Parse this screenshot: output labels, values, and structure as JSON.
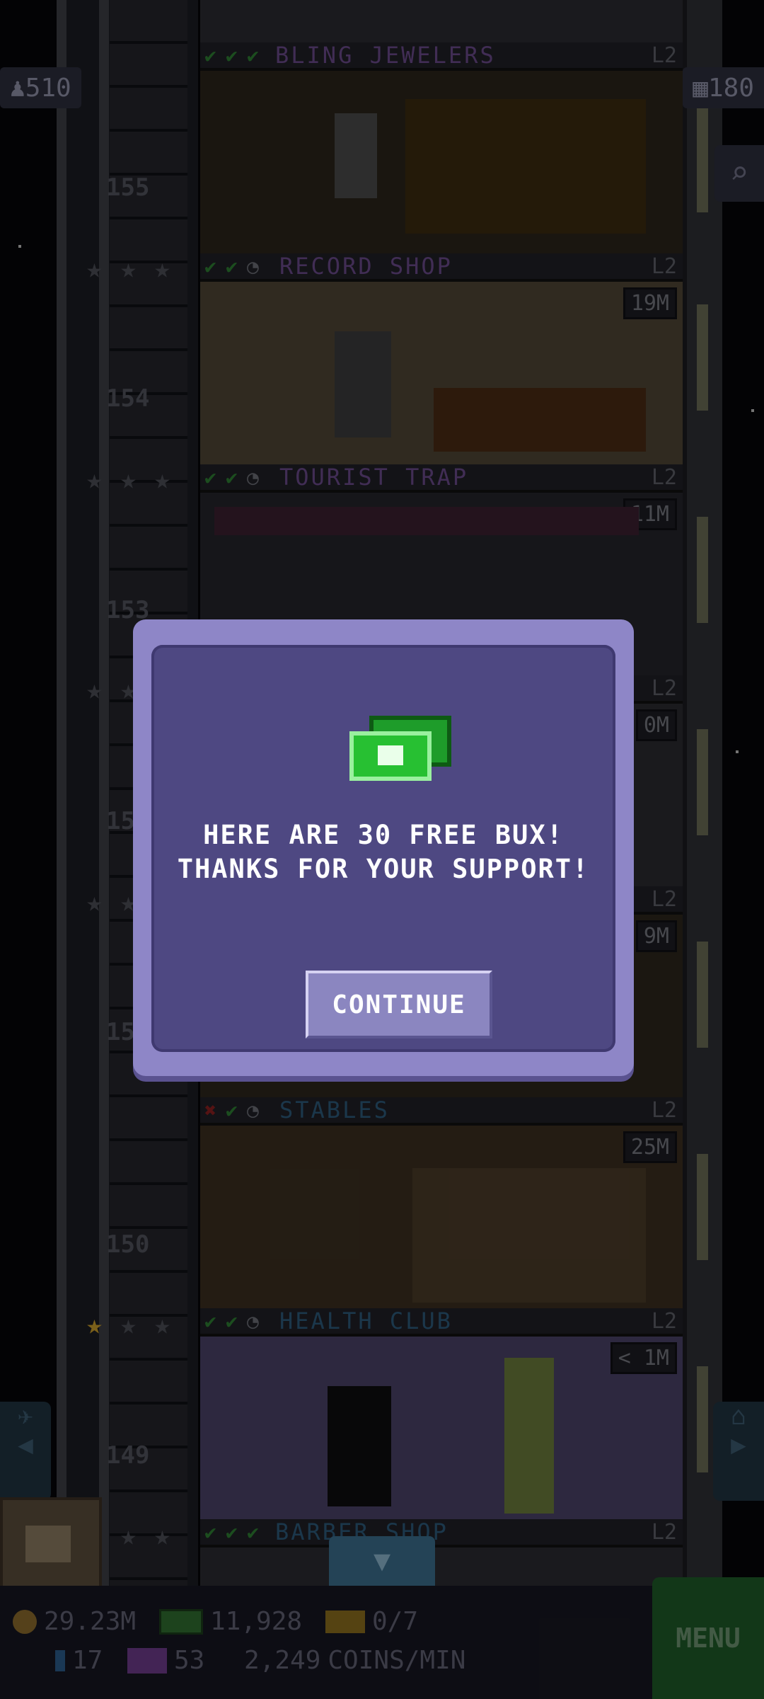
{
  "hud": {
    "population": "510",
    "floors": "180",
    "coins": "29.23M",
    "bux": "11,928",
    "vip": "0/7",
    "gems": "17",
    "tv": "53",
    "rate": "2,249",
    "rate_unit": "COINS/MIN",
    "menu": "MENU"
  },
  "floors": [
    {
      "name": "BLING JEWELERS",
      "number": "155",
      "level": "L2",
      "timer": "",
      "checks": "✔✔✔",
      "color": "#6a4a8a"
    },
    {
      "name": "RECORD SHOP",
      "number": "154",
      "level": "L2",
      "timer": "19M",
      "checks": "✔✔",
      "color": "#6a4a8a"
    },
    {
      "name": "TOURIST TRAP",
      "number": "153",
      "level": "L2",
      "timer": "11M",
      "checks": "✔✔",
      "color": "#6a4a8a"
    },
    {
      "name": "STABLES",
      "number": "150",
      "level": "L2",
      "timer": "25M",
      "checks": "✔",
      "color": "#2d5a7a"
    },
    {
      "name": "HEALTH CLUB",
      "number": "149",
      "level": "L2",
      "timer": "< 1M",
      "checks": "✔✔",
      "color": "#2d5a7a"
    },
    {
      "name": "BARBER SHOP",
      "number": "",
      "level": "L2",
      "timer": "",
      "checks": "✔✔✔",
      "color": "#2d5a7a"
    }
  ],
  "hidden_labels": {
    "f152_level": "L2",
    "f152_timer": "0M",
    "f152_num": "15",
    "f151_level": "L2",
    "f151_timer": "9M",
    "f151_num": "15"
  },
  "dialog": {
    "line1": "HERE ARE 30 FREE BUX!",
    "line2": "THANKS FOR YOUR SUPPORT!",
    "button": "CONTINUE"
  }
}
